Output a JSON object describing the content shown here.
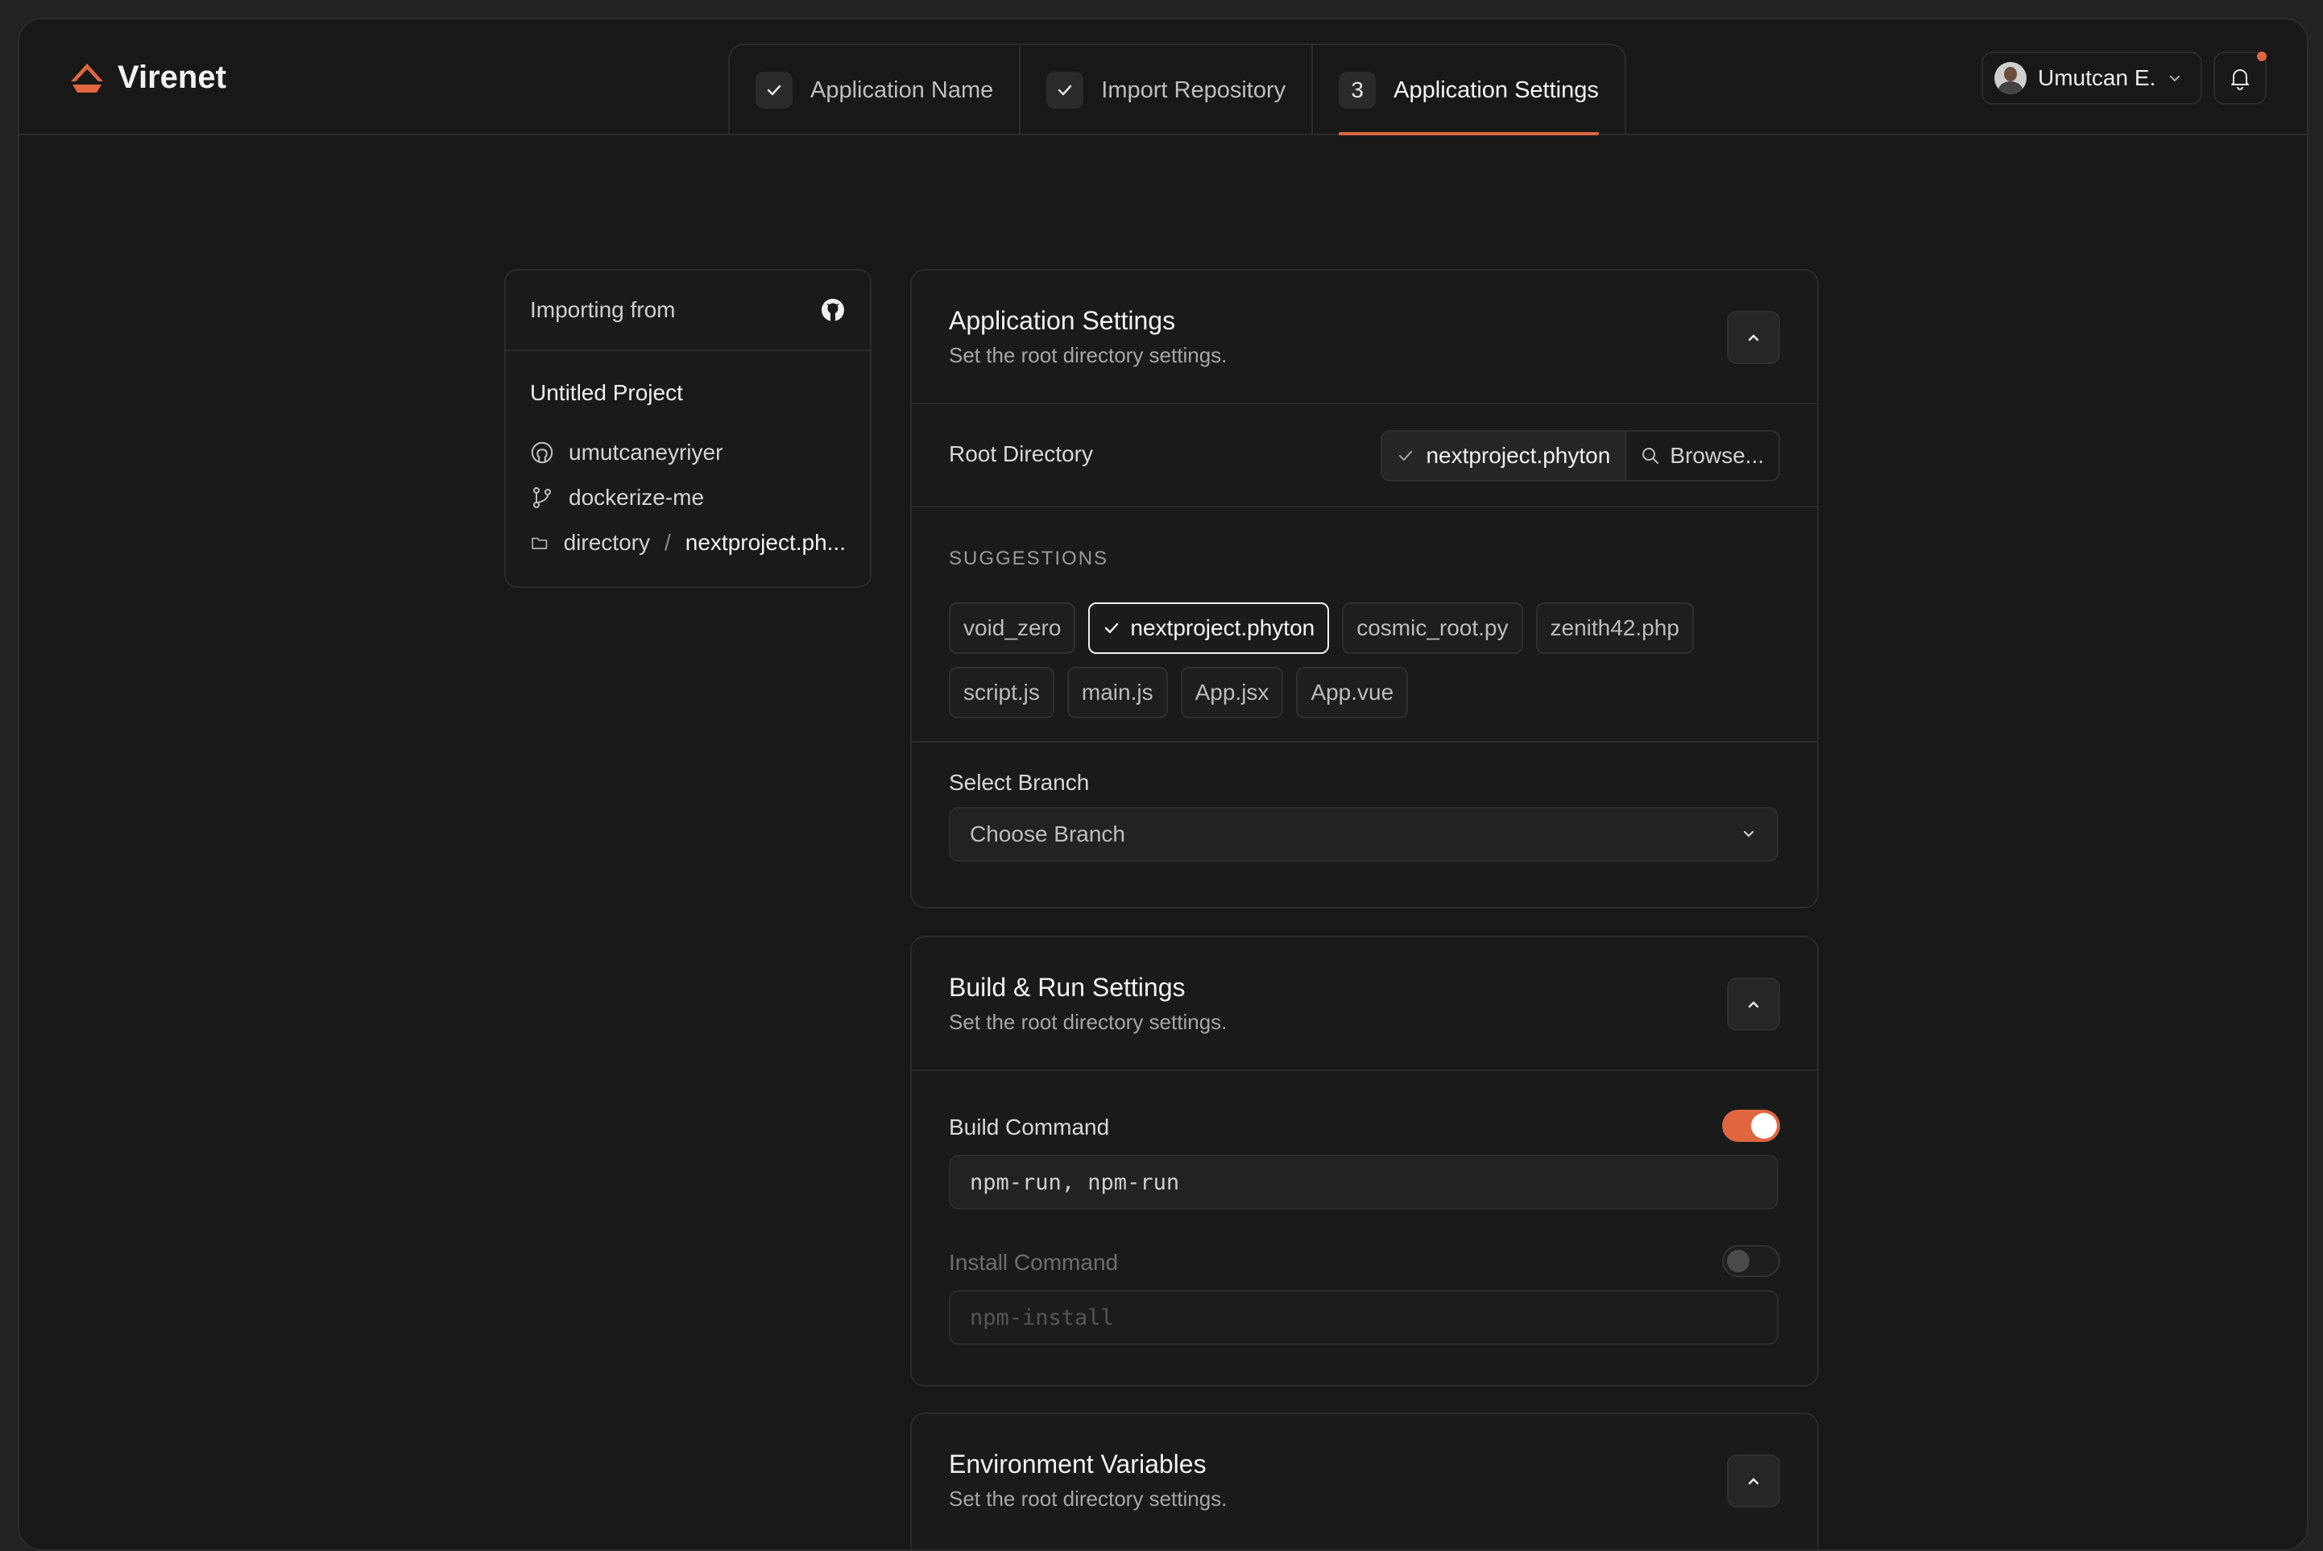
{
  "app": {
    "brand": "Virenet",
    "accent": "#e0663f"
  },
  "steps": [
    {
      "label": "Application Name",
      "status": "done"
    },
    {
      "label": "Import Repository",
      "status": "done"
    },
    {
      "label": "Application Settings",
      "number": "3",
      "status": "active"
    }
  ],
  "user": {
    "name": "Umutcan E."
  },
  "import_card": {
    "heading": "Importing from",
    "project": "Untitled Project",
    "owner": "umutcaneyriyer",
    "branch": "dockerize-me",
    "path_root": "directory",
    "path_sep": "/",
    "path_leaf": "nextproject.ph..."
  },
  "app_settings": {
    "title": "Application Settings",
    "subtitle": "Set the root directory settings.",
    "root_label": "Root Directory",
    "root_value": "nextproject.phyton",
    "browse_label": "Browse...",
    "suggestions_label": "SUGGESTIONS",
    "suggestions": [
      "void_zero",
      "nextproject.phyton",
      "cosmic_root.py",
      "zenith42.php",
      "script.js",
      "main.js",
      "App.jsx",
      "App.vue"
    ],
    "selected_suggestion": "nextproject.phyton",
    "branch_label": "Select Branch",
    "branch_placeholder": "Choose Branch"
  },
  "build_settings": {
    "title": "Build & Run Settings",
    "subtitle": "Set the root directory settings.",
    "build_label": "Build Command",
    "build_enabled": true,
    "build_value": "npm-run, npm-run",
    "install_label": "Install Command",
    "install_enabled": false,
    "install_placeholder": "npm-install"
  },
  "env_settings": {
    "title": "Environment Variables",
    "subtitle": "Set the root directory settings."
  }
}
